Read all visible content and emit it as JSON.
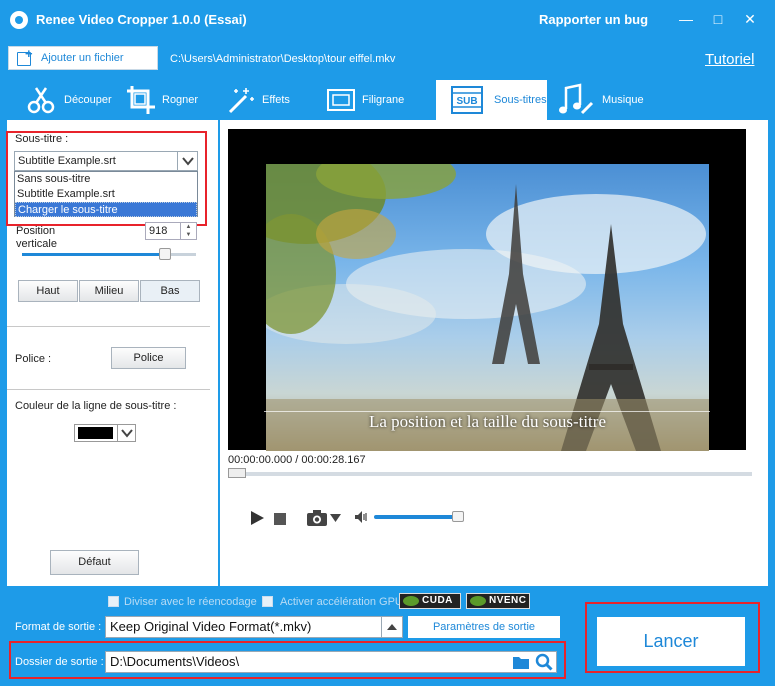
{
  "app": {
    "title": "Renee Video Cropper 1.0.0 (Essai)",
    "report_bug": "Rapporter un bug",
    "minimize": "—",
    "maximize": "□",
    "close": "✕"
  },
  "toolbar": {
    "add_file": "Ajouter un fichier",
    "file_path": "C:\\Users\\Administrator\\Desktop\\tour eiffel.mkv",
    "tutorial": "Tutoriel"
  },
  "tabs": [
    {
      "label": "Découper",
      "icon": "scissors-icon"
    },
    {
      "label": "Rogner",
      "icon": "crop-icon"
    },
    {
      "label": "Effets",
      "icon": "magic-wand-icon"
    },
    {
      "label": "Filigrane",
      "icon": "watermark-icon"
    },
    {
      "label": "Sous-titres",
      "icon": "subtitle-icon",
      "active": true
    },
    {
      "label": "Musique",
      "icon": "music-icon"
    }
  ],
  "left_panel": {
    "subtitle_label": "Sous-titre :",
    "subtitle_selected": "Subtitle Example.srt",
    "subtitle_options": [
      "Sans sous-titre",
      "Subtitle Example.srt",
      "Charger le sous-titre"
    ],
    "highlighted_option": "Charger le sous-titre",
    "position_label_1": "Position",
    "position_label_2": "verticale",
    "position_value": "918",
    "position_slider_fraction": 0.82,
    "pos_buttons": [
      "Haut",
      "Milieu",
      "Bas"
    ],
    "active_pos_button": "Bas",
    "font_label": "Police :",
    "font_button": "Police",
    "line_color_label": "Couleur de la ligne de sous-titre :",
    "line_color": "#000000",
    "default_button": "Défaut"
  },
  "player": {
    "subtitle_preview": "La position et la taille du sous-titre",
    "time": "00:00:00.000 / 00:00:28.167",
    "progress_fraction": 0,
    "volume_fraction": 1.0
  },
  "bottom": {
    "reencode_label": "Diviser avec le réencodage",
    "gpu_label": "Activer accélération GPU",
    "cuda": "CUDA",
    "nvenc": "NVENC",
    "format_label": "Format de sortie :",
    "format_value": "Keep Original Video Format(*.mkv)",
    "output_params": "Paramètres de sortie",
    "folder_label": "Dossier de sortie :",
    "folder_value": "D:\\Documents\\Videos\\",
    "launch": "Lancer"
  },
  "colors": {
    "accent": "#1e9be8",
    "highlight_box": "#e8232b"
  }
}
